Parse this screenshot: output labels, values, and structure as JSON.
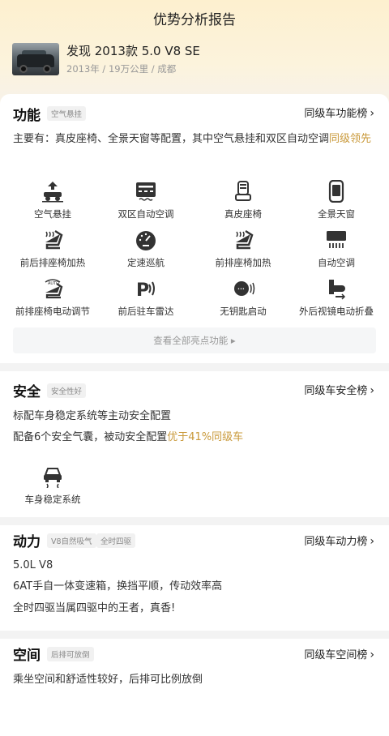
{
  "header": {
    "title": "优势分析报告",
    "car_name": "发现 2013款 5.0 V8 SE",
    "car_meta": "2013年 / 19万公里 / 成都"
  },
  "function": {
    "title": "功能",
    "tag": "空气悬挂",
    "rank_link": "同级车功能榜",
    "desc_main": "主要有：真皮座椅、全景天窗等配置，其中空气悬挂和双区自动空调",
    "desc_highlight": "同级领先",
    "features": [
      {
        "label": "空气悬挂",
        "icon": "air-suspension-icon"
      },
      {
        "label": "双区自动空调",
        "icon": "dual-zone-ac-icon"
      },
      {
        "label": "真皮座椅",
        "icon": "leather-seat-icon"
      },
      {
        "label": "全景天窗",
        "icon": "panoramic-sunroof-icon"
      },
      {
        "label": "前后排座椅加热",
        "icon": "seat-heating-icon"
      },
      {
        "label": "定速巡航",
        "icon": "cruise-control-icon"
      },
      {
        "label": "前排座椅加热",
        "icon": "front-seat-heating-icon"
      },
      {
        "label": "自动空调",
        "icon": "auto-ac-icon"
      },
      {
        "label": "前排座椅电动调节",
        "icon": "power-seat-icon"
      },
      {
        "label": "前后驻车雷达",
        "icon": "parking-radar-icon"
      },
      {
        "label": "无钥匙启动",
        "icon": "keyless-start-icon"
      },
      {
        "label": "外后视镜电动折叠",
        "icon": "mirror-fold-icon"
      }
    ],
    "more_label": "查看全部亮点功能 ▸"
  },
  "safety": {
    "title": "安全",
    "tag": "安全性好",
    "rank_link": "同级车安全榜",
    "line1": "标配车身稳定系统等主动安全配置",
    "line2_main": "配备6个安全气囊，被动安全配置",
    "line2_highlight": "优于41%同级车",
    "feature_label": "车身稳定系统",
    "feature_icon": "stability-control-icon"
  },
  "power": {
    "title": "动力",
    "tags": [
      "V8自然吸气",
      "全时四驱"
    ],
    "rank_link": "同级车动力榜",
    "lines": [
      "5.0L V8",
      "6AT手自一体变速箱，换挡平顺，传动效率高",
      "全时四驱当属四驱中的王者，真香!"
    ]
  },
  "space": {
    "title": "空间",
    "tag": "后排可放倒",
    "rank_link": "同级车空间榜",
    "desc": "乘坐空间和舒适性较好，后排可比例放倒"
  },
  "colors": {
    "accent": "#c9993a",
    "header_bg": "#fdf0cf"
  }
}
